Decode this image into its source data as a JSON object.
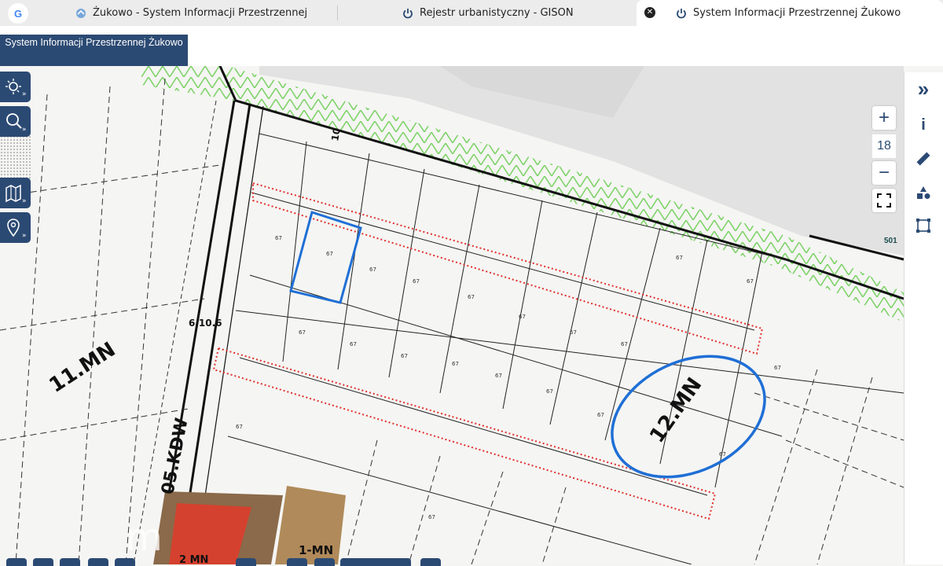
{
  "browser": {
    "tabs": [
      {
        "title": "Żukowo - System Informacji Przestrzennej",
        "active": false
      },
      {
        "title": "Rejestr urbanistyczny - GISON",
        "active": false
      },
      {
        "title": "System Informacji Przestrzennej Żukowo",
        "active": true
      }
    ],
    "logo_letter": "G",
    "close_glyph": "✕"
  },
  "app": {
    "title": "System Informacji Przestrzennej Żukowo"
  },
  "zoom": {
    "plus": "+",
    "minus": "−",
    "level": "18"
  },
  "map": {
    "labels": {
      "zone_11mn": "11.MN",
      "zone_12mn": "12.MN",
      "road_05kdw": "05.KDW",
      "zone_1mn": "1-MN",
      "zone_2mn": "2 MN",
      "road_610": "6.10.6",
      "road_10": "10",
      "badge_501": "501",
      "watermark": "m"
    },
    "colors": {
      "boundary_red": "#e0302a",
      "highlight_blue": "#1f6fd6",
      "green_hatch": "#7fd36a",
      "brand_navy": "#2b4a73"
    }
  },
  "toolbar_right": {
    "collapse": "»",
    "info": "i"
  }
}
